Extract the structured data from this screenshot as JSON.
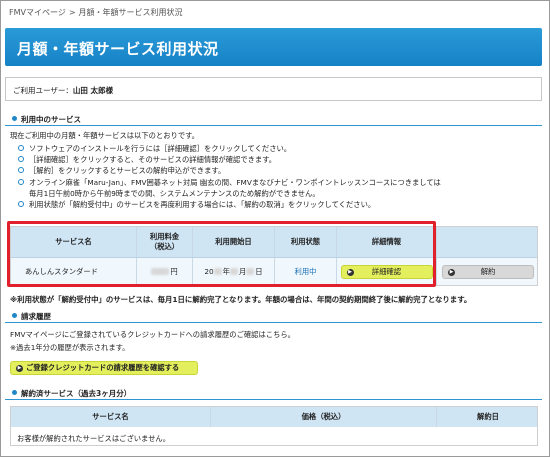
{
  "breadcrumb": {
    "items": [
      "FMVマイページ",
      ">",
      "月額・年額サービス利用状況"
    ]
  },
  "page": {
    "title": "月額・年額サービス利用状況"
  },
  "user": {
    "label": "ご利用ユーザー：",
    "name": "山田 太郎様"
  },
  "current": {
    "heading": "利用中のサービス",
    "intro": "現在ご利用中の月額・年額サービスは以下のとおりです。",
    "bullets": [
      "ソフトウェアのインストールを行うには［詳細確認］をクリックしてください。",
      "［詳細確認］をクリックすると、そのサービスの詳細情報が確認できます。",
      "［解約］をクリックするとサービスの解約申込ができます。",
      "オンライン麻雀「Maru-Jan」、FMV囲碁ネット対局 幽玄の間、FMVまなびナビ・ワンポイントレッスンコースにつきましては",
      "毎月1日午前0時から午前9時までの間、システムメンテナンスのため解約ができません。",
      "利用状態が「解約受付中」のサービスを再度利用する場合には、「解約の取消」をクリックしてください。"
    ],
    "table": {
      "headers": [
        "サービス名",
        "利用料金（税込）",
        "利用開始日",
        "利用状態",
        "詳細情報",
        ""
      ],
      "row": {
        "name": "あんしんスタンダード",
        "price_suffix": "円",
        "date_prefix": "20",
        "date_mid1": "年",
        "date_mid2": "月",
        "date_suffix": "日",
        "status": "利用中",
        "detail_button": "詳細確認",
        "cancel_button": "解約"
      }
    },
    "note": "※利用状態が「解約受付中」のサービスは、毎月1日に解約完了となります。年額の場合は、年間の契約期間終了後に解約完了となります。"
  },
  "billing": {
    "heading": "請求履歴",
    "line1": "FMVマイページにご登録されているクレジットカードへの請求履歴のご確認はこちら。",
    "line2": "※過去1年分の履歴が表示されます。",
    "button": "ご登録クレジットカードの請求履歴を確認する"
  },
  "cancelled": {
    "heading": "解約済サービス（過去3ヶ月分）",
    "headers": [
      "サービス名",
      "価格（税込）",
      "解約日"
    ],
    "empty": "お客様が解約されたサービスはございません。"
  },
  "colors": {
    "accent": "#1682c6",
    "highlight": "#e0202a",
    "button_yellow": "#e3ef5c"
  }
}
